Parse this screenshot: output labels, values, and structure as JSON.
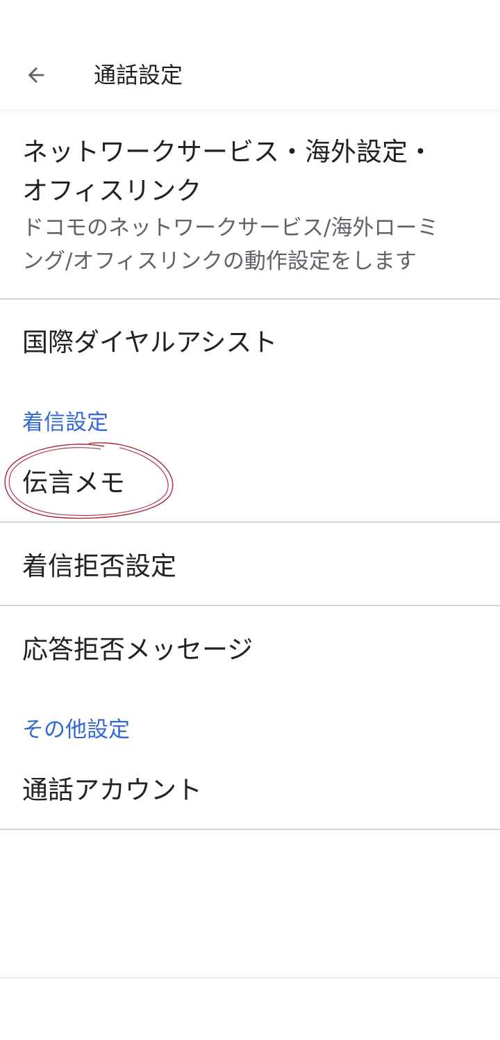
{
  "header": {
    "title": "通話設定",
    "back_icon": "arrow-back-icon"
  },
  "items": {
    "network": {
      "title_line1": "ネットワークサービス・海外設定・",
      "title_line2": "オフィスリンク",
      "summary_line1": "ドコモのネットワークサービス/海外ローミ",
      "summary_line2": "ング/オフィスリンクの動作設定をします"
    },
    "intl_dial": {
      "title": "国際ダイヤルアシスト"
    },
    "voice_memo": {
      "title": "伝言メモ"
    },
    "call_reject": {
      "title": "着信拒否設定"
    },
    "reject_message": {
      "title": "応答拒否メッセージ"
    },
    "call_accounts": {
      "title": "通話アカウント"
    }
  },
  "categories": {
    "incoming": "着信設定",
    "other": "その他設定"
  },
  "colors": {
    "accent": "#3367d6",
    "annotation": "#b0213a",
    "divider": "#d3d3d3",
    "text_primary": "#202124",
    "text_secondary": "#5f6368"
  }
}
